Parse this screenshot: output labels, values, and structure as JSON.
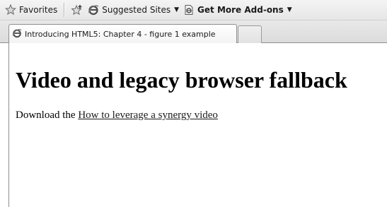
{
  "favorites_bar": {
    "favorites_label": "Favorites",
    "suggested_sites_label": "Suggested Sites",
    "get_addons_label": "Get More Add-ons"
  },
  "tabs": [
    {
      "label": "Introducing HTML5: Chapter 4 - figure 1 example"
    }
  ],
  "page": {
    "heading": "Video and legacy browser fallback",
    "download_prefix": "Download the",
    "download_link": "How to leverage a synergy video"
  },
  "icons": {
    "favorites": "star-icon",
    "add_favorite": "add-favorite-icon",
    "suggested_sites": "ie-icon",
    "addons": "page-icon",
    "tab": "ie-icon"
  }
}
